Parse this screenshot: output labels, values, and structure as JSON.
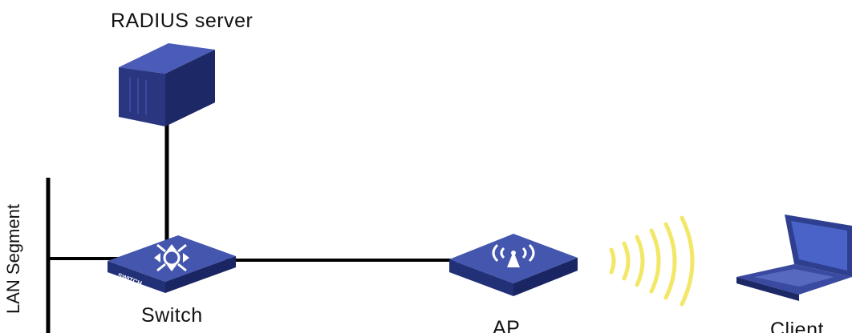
{
  "nodes": {
    "radius_server": {
      "label": "RADIUS server",
      "icon": "server-icon"
    },
    "switch": {
      "label": "Switch",
      "icon": "switch-icon",
      "badge": "SWITCH"
    },
    "ap": {
      "label": "AP",
      "icon": "access-point-icon"
    },
    "client": {
      "label": "Client",
      "icon": "laptop-icon"
    }
  },
  "lan_segment": {
    "label": "LAN Segment"
  },
  "links": [
    {
      "from": "radius_server",
      "to": "switch",
      "type": "wired"
    },
    {
      "from": "lan_segment",
      "to": "switch",
      "type": "wired"
    },
    {
      "from": "switch",
      "to": "ap",
      "type": "wired"
    },
    {
      "from": "ap",
      "to": "client",
      "type": "wireless"
    }
  ],
  "colors": {
    "device": "#2f3f8f",
    "device_light": "#4a5cb8",
    "line": "#000000",
    "wireless": "#f5e96a"
  }
}
